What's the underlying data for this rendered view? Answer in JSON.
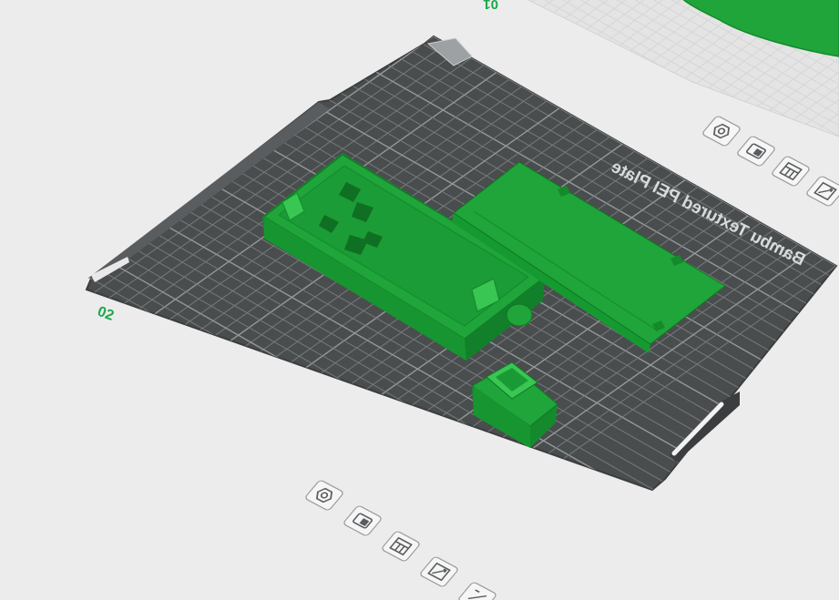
{
  "viewport": {
    "background": "#ececec",
    "plate_color": "#4a4d4e",
    "grid_color": "#8a8d8f",
    "model_color": "#1fa53a",
    "model_dark": "#148a2c",
    "model_light": "#39c653",
    "accent_color": "#1aa94a"
  },
  "plate_main": {
    "label": "Bambu Textured PEI Plate",
    "number": "02"
  },
  "plate_neighbor": {
    "number": "01"
  },
  "plate_tools_main": [
    {
      "icon": "orient-icon"
    },
    {
      "icon": "lock-plate-icon"
    },
    {
      "icon": "arrange-icon"
    },
    {
      "icon": "plate-settings-icon"
    },
    {
      "icon": "slice-plate-icon"
    }
  ],
  "plate_tools_neighbor": [
    {
      "icon": "orient-icon"
    },
    {
      "icon": "lock-plate-icon"
    },
    {
      "icon": "arrange-icon"
    },
    {
      "icon": "plate-settings-icon"
    }
  ],
  "objects": [
    {
      "name": "enclosure-base"
    },
    {
      "name": "enclosure-lid"
    },
    {
      "name": "button-cap"
    }
  ]
}
